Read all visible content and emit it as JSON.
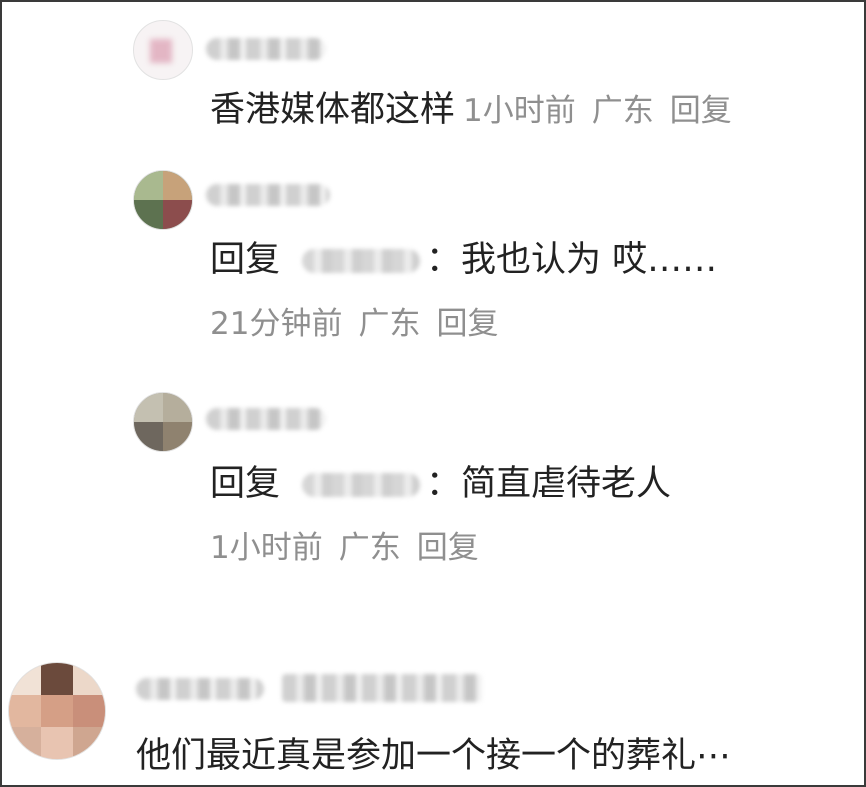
{
  "comments": [
    {
      "text": "香港媒体都这样",
      "time": "1小时前",
      "location": "广东",
      "reply_label": "回复"
    },
    {
      "reply_prefix": "回复",
      "colon": "：",
      "text": "我也认为 哎……",
      "time": "21分钟前",
      "location": "广东",
      "reply_label": "回复"
    },
    {
      "reply_prefix": "回复",
      "colon": "：",
      "text": "简直虐待老人",
      "time": "1小时前",
      "location": "广东",
      "reply_label": "回复"
    },
    {
      "text": "他们最近真是参加一个接一个的葬礼⋯"
    }
  ],
  "colors": {
    "text": "#222222",
    "meta": "#8f8f8f",
    "border": "#3a3a3a"
  }
}
